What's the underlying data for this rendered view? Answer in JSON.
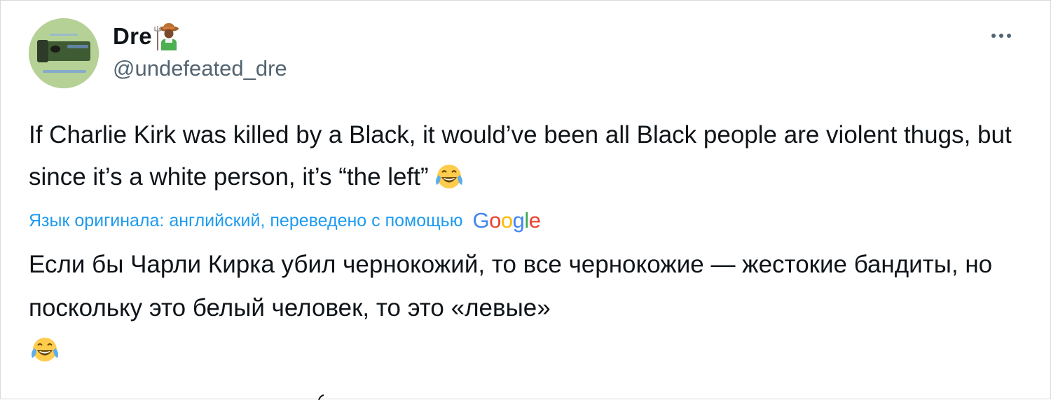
{
  "user": {
    "display_name": "Dre",
    "handle": "@undefeated_dre",
    "avatar_icon": "avatar-image",
    "name_emoji": "farmer-emoji"
  },
  "menu": {
    "more_icon": "more-options-icon"
  },
  "tweet": {
    "text": "If Charlie Kirk was killed by a Black, it would’ve been all Black people are violent thugs, but since it’s a white person, it’s “the left”",
    "emoji": "face-with-tears-of-joy-emoji"
  },
  "translation": {
    "label": "Язык оригинала: английский, переведено с помощью",
    "provider": {
      "letters": [
        {
          "ch": "G",
          "color": "#4285F4"
        },
        {
          "ch": "o",
          "color": "#EA4335"
        },
        {
          "ch": "o",
          "color": "#FBBC05"
        },
        {
          "ch": "g",
          "color": "#4285F4"
        },
        {
          "ch": "l",
          "color": "#34A853"
        },
        {
          "ch": "e",
          "color": "#EA4335"
        }
      ]
    },
    "text": "Если бы Чарли Кирка убил чернокожий, то все чернокожие — жестокие бандиты, но поскольку это белый человек, то это «левые»"
  },
  "colors": {
    "link": "#1d9bf0",
    "secondary_text": "#536471",
    "primary_text": "#0f1419"
  }
}
